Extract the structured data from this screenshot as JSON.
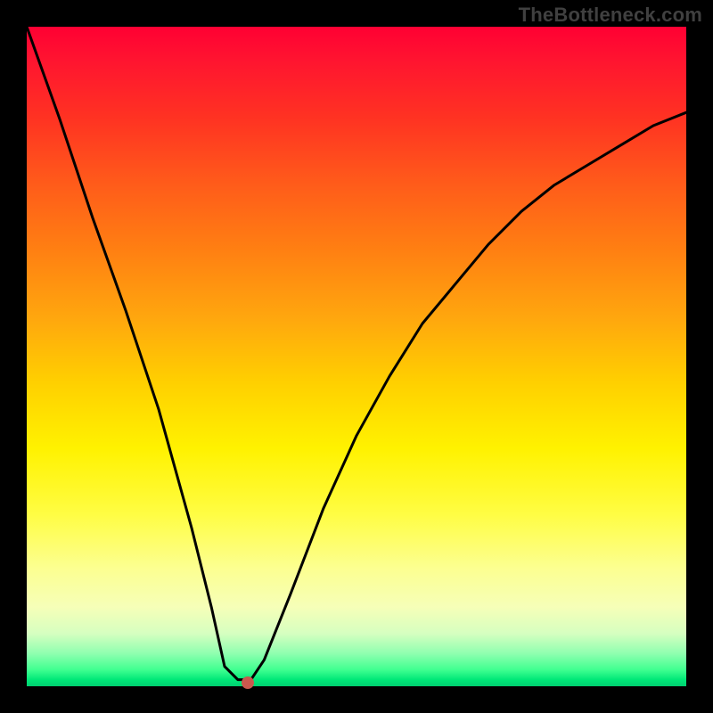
{
  "watermark": "TheBottleneck.com",
  "chart_data": {
    "type": "line",
    "title": "",
    "xlabel": "",
    "ylabel": "",
    "xlim": [
      0,
      1
    ],
    "ylim": [
      0,
      1
    ],
    "grid": false,
    "legend": false,
    "gradient": {
      "direction": "vertical",
      "stops": [
        {
          "pos": 0.0,
          "color": "#ff0033"
        },
        {
          "pos": 0.5,
          "color": "#ffd000"
        },
        {
          "pos": 0.8,
          "color": "#fcff90"
        },
        {
          "pos": 1.0,
          "color": "#00d070"
        }
      ]
    },
    "series": [
      {
        "name": "bottleneck-curve",
        "x": [
          0.0,
          0.05,
          0.1,
          0.15,
          0.2,
          0.25,
          0.28,
          0.3,
          0.32,
          0.34,
          0.36,
          0.4,
          0.45,
          0.5,
          0.55,
          0.6,
          0.65,
          0.7,
          0.75,
          0.8,
          0.85,
          0.9,
          0.95,
          1.0
        ],
        "y": [
          1.0,
          0.86,
          0.71,
          0.57,
          0.42,
          0.24,
          0.12,
          0.03,
          0.01,
          0.01,
          0.04,
          0.14,
          0.27,
          0.38,
          0.47,
          0.55,
          0.61,
          0.67,
          0.72,
          0.76,
          0.79,
          0.82,
          0.85,
          0.87
        ]
      }
    ],
    "marker": {
      "x": 0.335,
      "y": 0.005,
      "color": "#c9584e"
    }
  }
}
